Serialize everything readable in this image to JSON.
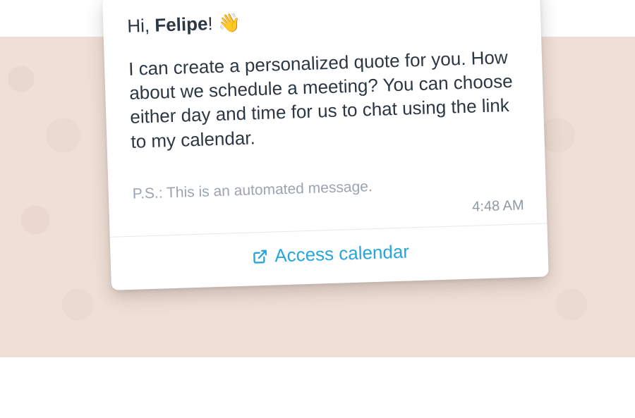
{
  "message": {
    "greeting_prefix": "Hi, ",
    "name": "Felipe",
    "greeting_suffix": "! ",
    "wave_emoji": "👋",
    "body": "I can create a personalized quote for you. How about we schedule a meeting? You can choose either day and time for us to chat using the link to my calendar.",
    "postscript": "P.S.: This is an automated message.",
    "timestamp": "4:48 AM"
  },
  "cta": {
    "label": "Access calendar"
  }
}
